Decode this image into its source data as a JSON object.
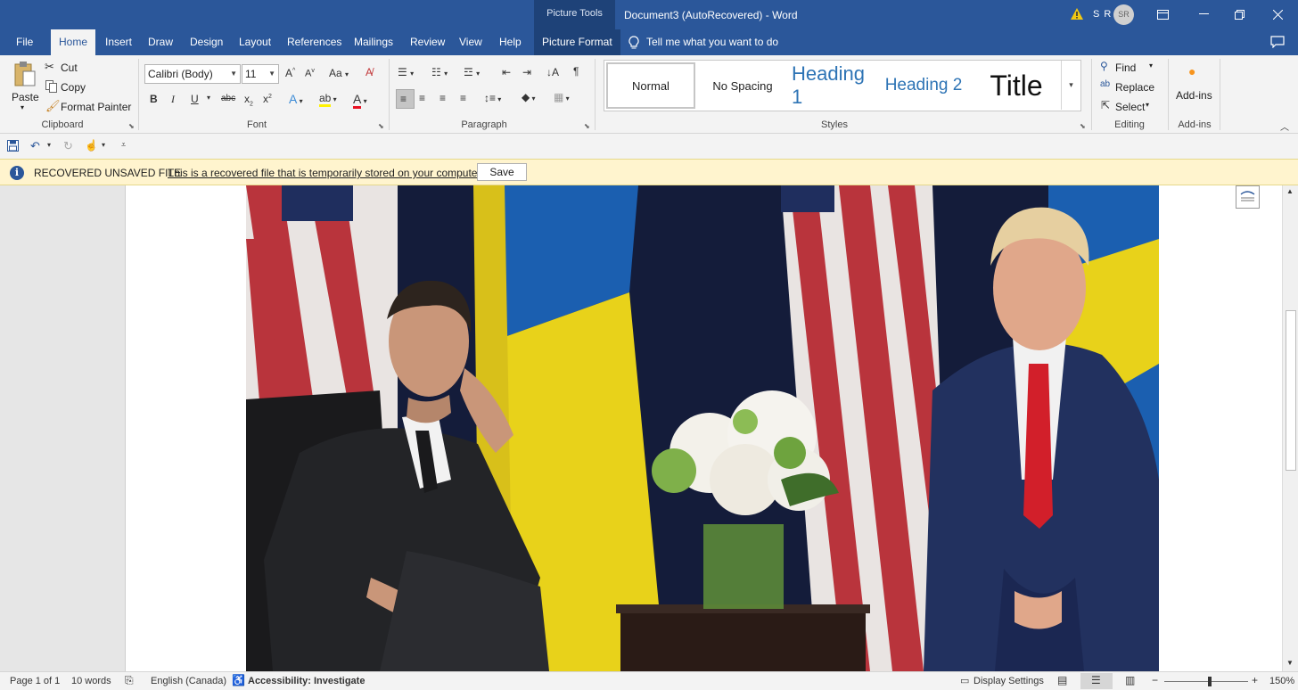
{
  "titlebar": {
    "context_tab": "Picture Tools",
    "document_title": "Document3 (AutoRecovered)  -  Word",
    "user_initials": "S R",
    "avatar_text": "SR"
  },
  "tabs": [
    {
      "label": "File"
    },
    {
      "label": "Home"
    },
    {
      "label": "Insert"
    },
    {
      "label": "Draw"
    },
    {
      "label": "Design"
    },
    {
      "label": "Layout"
    },
    {
      "label": "References"
    },
    {
      "label": "Mailings"
    },
    {
      "label": "Review"
    },
    {
      "label": "View"
    },
    {
      "label": "Help"
    },
    {
      "label": "Picture Format"
    }
  ],
  "tell_me": "Tell me what you want to do",
  "clipboard": {
    "paste": "Paste",
    "cut": "Cut",
    "copy": "Copy",
    "format_painter": "Format Painter",
    "label": "Clipboard"
  },
  "font": {
    "name": "Calibri (Body)",
    "size": "11",
    "change_case": "Aa",
    "label": "Font"
  },
  "paragraph": {
    "label": "Paragraph"
  },
  "styles": {
    "items": [
      "Normal",
      "No Spacing",
      "Heading 1",
      "Heading 2",
      "Title"
    ],
    "label": "Styles"
  },
  "editing": {
    "find": "Find",
    "replace": "Replace",
    "select": "Select",
    "label": "Editing"
  },
  "addins": {
    "button": "Add-ins",
    "label": "Add-ins"
  },
  "message_bar": {
    "title": "RECOVERED UNSAVED FILE",
    "text": "This is a recovered file that is temporarily stored on your computer.",
    "button": "Save"
  },
  "status": {
    "page": "Page 1 of 1",
    "words": "10 words",
    "language": "English (Canada)",
    "accessibility": "Accessibility: Investigate",
    "display_settings": "Display Settings",
    "zoom": "150%"
  },
  "colors": {
    "brand": "#2b579a",
    "ribbon": "#f3f3f3",
    "message_bar": "#fff4ce"
  }
}
